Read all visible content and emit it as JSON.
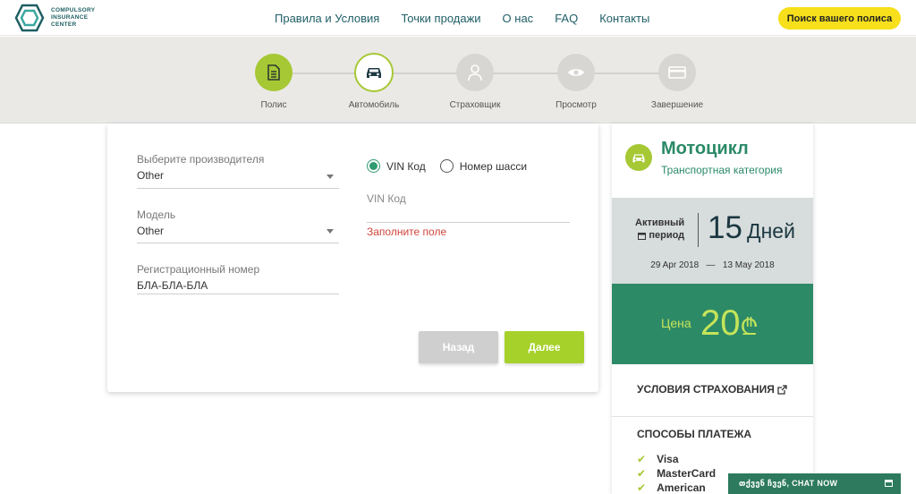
{
  "header": {
    "logo_text": "COMPULSORY INSURANCE CENTER",
    "nav": [
      "Правила и Условия",
      "Точки продажи",
      "О нас",
      "FAQ",
      "Контакты"
    ],
    "search_button": "Поиск вашего полиса"
  },
  "stepper": {
    "steps": [
      {
        "label": "Полис",
        "icon": "document-icon",
        "state": "done"
      },
      {
        "label": "Автомобиль",
        "icon": "car-icon",
        "state": "active"
      },
      {
        "label": "Страховщик",
        "icon": "person-icon",
        "state": "pending"
      },
      {
        "label": "Просмотр",
        "icon": "eye-icon",
        "state": "pending"
      },
      {
        "label": "Завершение",
        "icon": "card-icon",
        "state": "pending"
      }
    ]
  },
  "form": {
    "manufacturer": {
      "label": "Выберите производителя",
      "value": "Other"
    },
    "model": {
      "label": "Модель",
      "value": "Other"
    },
    "registration": {
      "label": "Регистрационный номер",
      "value": "БЛА-БЛА-БЛА"
    },
    "radio": {
      "vin": "VIN Код",
      "chassis": "Номер шасси",
      "selected": "vin"
    },
    "vin": {
      "label": "VIN Код",
      "value": ""
    },
    "error": "Заполните поле",
    "back_button": "Назад",
    "next_button": "Далее"
  },
  "panel": {
    "vehicle_name": "Мотоцикл",
    "vehicle_category": "Транспортная категория",
    "period": {
      "label_line1": "Активный",
      "label_line2": "период",
      "days": "15",
      "unit": "Дней",
      "date_from": "29 Apr 2018",
      "date_to": "13 May 2018",
      "separator": "—"
    },
    "price": {
      "label": "Цена",
      "value": "20",
      "currency": "₾"
    },
    "terms": "УСЛОВИЯ СТРАХОВАНИЯ",
    "payments_title": "СПОСОБЫ ПЛАТЕЖА",
    "payments": [
      "Visa",
      "MasterCard",
      "American"
    ]
  },
  "chat": {
    "label": "თქვენ ჩვენ, CHAT NOW"
  },
  "colors": {
    "accent_green": "#a6c834",
    "dark_green": "#2d8a67",
    "yellow": "#f7e01b",
    "error": "#d0453b"
  }
}
